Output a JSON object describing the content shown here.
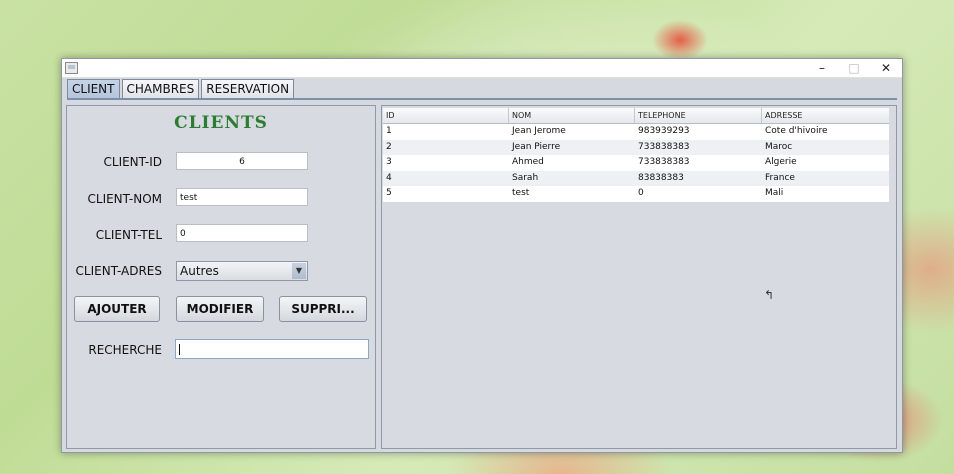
{
  "window": {
    "min_glyph": "–",
    "max_glyph": "□",
    "close_glyph": "✕"
  },
  "tabs": [
    {
      "label": "CLIENT",
      "active": true
    },
    {
      "label": "CHAMBRES",
      "active": false
    },
    {
      "label": "RESERVATION",
      "active": false
    }
  ],
  "form": {
    "title": "CLIENTS",
    "id_label": "CLIENT-ID",
    "id_value": "6",
    "nom_label": "CLIENT-NOM",
    "nom_value": "test",
    "tel_label": "CLIENT-TEL",
    "tel_value": "0",
    "adres_label": "CLIENT-ADRES",
    "adres_value": "Autres",
    "search_label": "RECHERCHE",
    "search_value": ""
  },
  "buttons": {
    "add": "AJOUTER",
    "edit": "MODIFIER",
    "delete": "SUPPRI..."
  },
  "table": {
    "columns": [
      "ID",
      "NOM",
      "TELEPHONE",
      "ADRESSE"
    ],
    "rows": [
      [
        "1",
        "Jean Jerome",
        "983939293",
        "Cote d'hivoire"
      ],
      [
        "2",
        "Jean Pierre",
        "733838383",
        "Maroc"
      ],
      [
        "3",
        "Ahmed",
        "733838383",
        "Algerie"
      ],
      [
        "4",
        "Sarah",
        "83838383",
        "France"
      ],
      [
        "5",
        "test",
        "0",
        "Mali"
      ]
    ]
  },
  "colors": {
    "title_green": "#2d7c33",
    "panel": "#d7dae0",
    "active_tab": "#b5c6dd"
  }
}
